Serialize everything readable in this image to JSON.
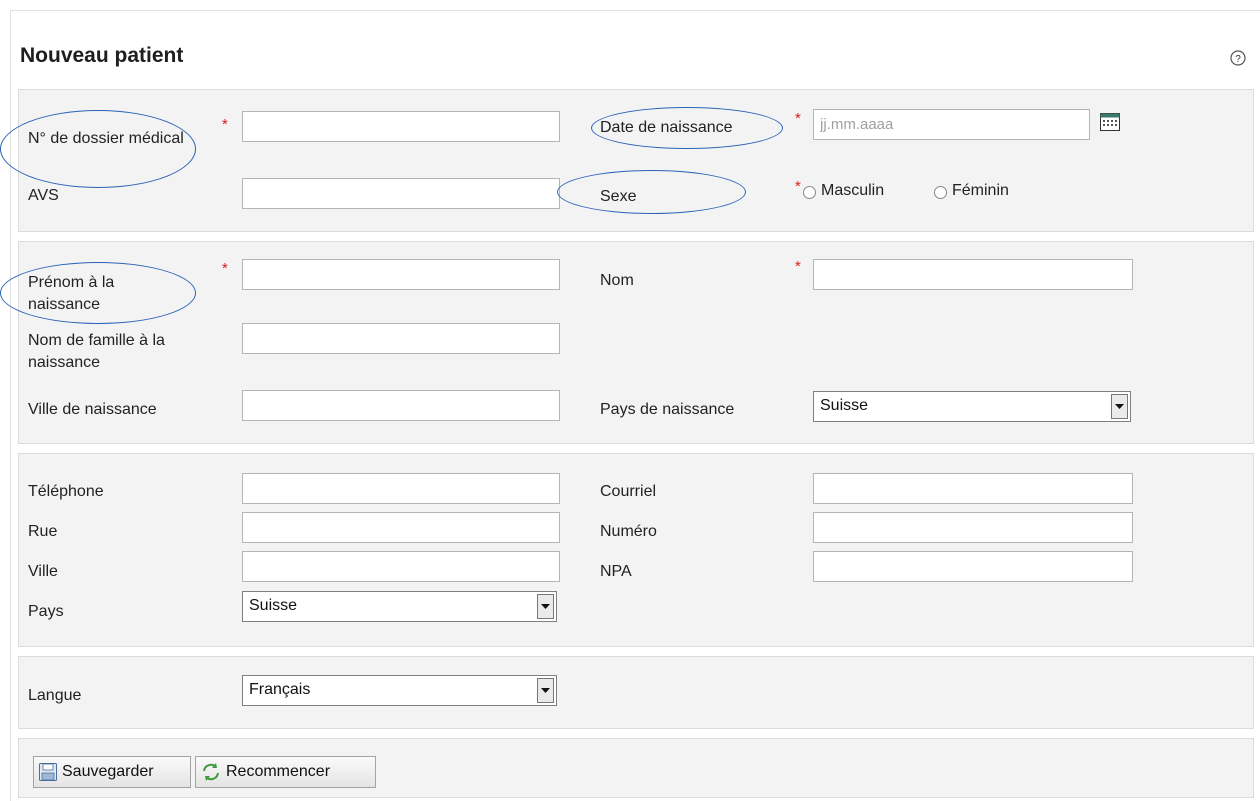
{
  "page": {
    "title": "Nouveau patient"
  },
  "icons": {
    "help": "help-icon",
    "calendar": "calendar-icon",
    "save": "floppy-disk-icon",
    "reset": "refresh-arrows-icon"
  },
  "colors": {
    "required": "#d42020",
    "annotation": "#2a62b8",
    "panel": "#f3f3f3"
  },
  "identity": {
    "dossier_label": "N° de dossier médical",
    "dossier_value": "",
    "avs_label": "AVS",
    "avs_value": "",
    "birthdate_label": "Date de naissance",
    "birthdate_value": "",
    "birthdate_placeholder": "jj.mm.aaaa",
    "sex_label": "Sexe",
    "sex_options": [
      "Masculin",
      "Féminin"
    ],
    "required_mark": "*"
  },
  "birth": {
    "firstname_label": "Prénom à la naissance",
    "firstname_value": "",
    "lastname_label": "Nom",
    "lastname_value": "",
    "familyname_label": "Nom de famille à la naissance",
    "familyname_value": "",
    "city_label": "Ville de naissance",
    "city_value": "",
    "country_label": "Pays de naissance",
    "country_value": "Suisse"
  },
  "contact": {
    "phone_label": "Téléphone",
    "email_label": "Courriel",
    "street_label": "Rue",
    "number_label": "Numéro",
    "city_label": "Ville",
    "zip_label": "NPA",
    "country_label": "Pays",
    "country_value": "Suisse"
  },
  "language": {
    "label": "Langue",
    "value": "Français"
  },
  "actions": {
    "save_label": "Sauvegarder",
    "reset_label": "Recommencer"
  }
}
